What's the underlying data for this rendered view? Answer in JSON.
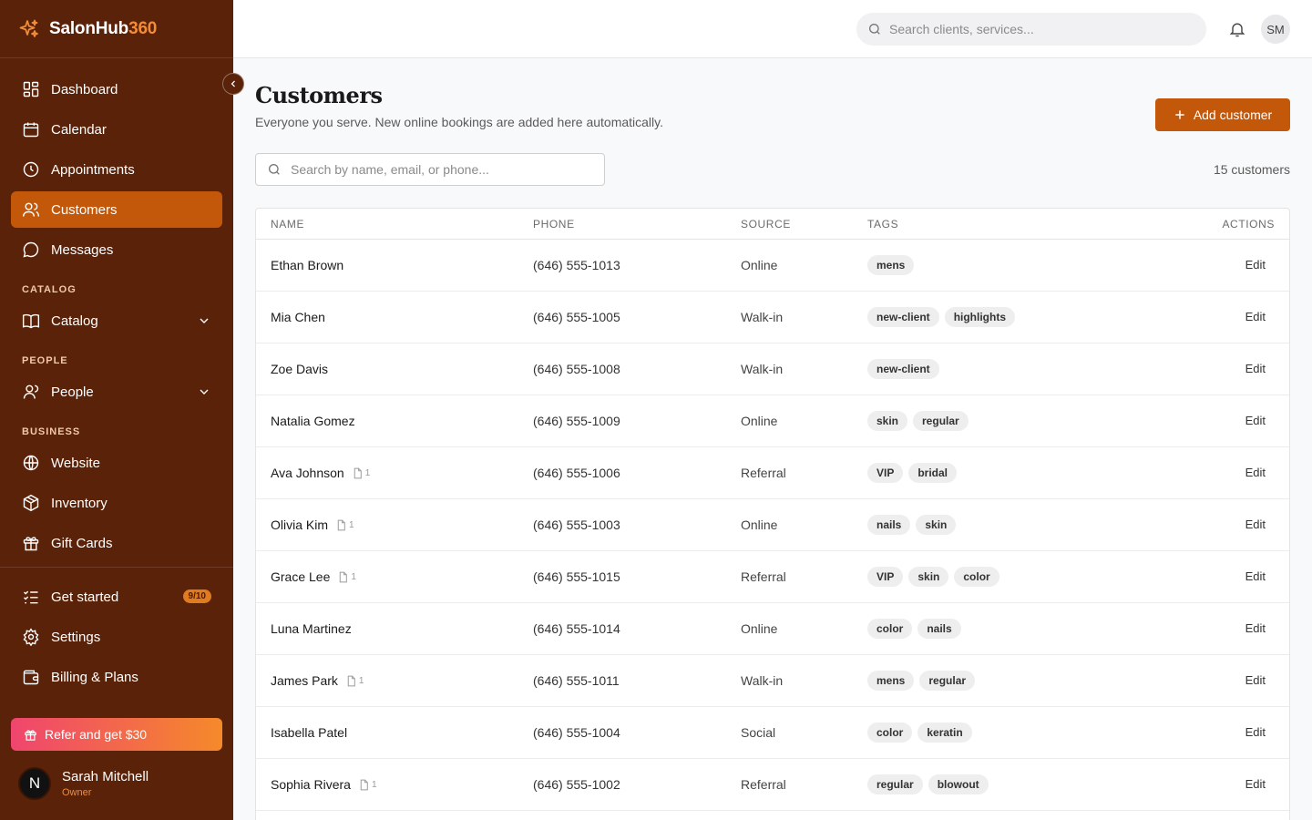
{
  "brand": {
    "name_main": "SalonHub",
    "name_accent": "360"
  },
  "sidebar": {
    "main_items": [
      {
        "label": "Dashboard",
        "icon": "grid-icon"
      },
      {
        "label": "Calendar",
        "icon": "calendar-icon"
      },
      {
        "label": "Appointments",
        "icon": "clock-icon"
      },
      {
        "label": "Customers",
        "icon": "users-icon",
        "active": true
      },
      {
        "label": "Messages",
        "icon": "message-icon"
      }
    ],
    "catalog_label": "CATALOG",
    "catalog_item": "Catalog",
    "people_label": "PEOPLE",
    "people_item": "People",
    "business_label": "BUSINESS",
    "business_items": [
      {
        "label": "Website",
        "icon": "globe-icon"
      },
      {
        "label": "Inventory",
        "icon": "box-icon"
      },
      {
        "label": "Gift Cards",
        "icon": "gift-icon"
      }
    ],
    "bottom_items": [
      {
        "label": "Get started",
        "icon": "checklist-icon",
        "badge": "9/10"
      },
      {
        "label": "Settings",
        "icon": "gear-icon"
      },
      {
        "label": "Billing & Plans",
        "icon": "wallet-icon"
      }
    ],
    "refer_label": "Refer and get $30",
    "user": {
      "initial": "N",
      "name": "Sarah Mitchell",
      "role": "Owner"
    }
  },
  "topbar": {
    "search_placeholder": "Search clients, services...",
    "avatar_initials": "SM"
  },
  "page": {
    "title": "Customers",
    "subtitle": "Everyone you serve. New online bookings are added here automatically.",
    "add_button": "Add customer",
    "search_placeholder": "Search by name, email, or phone...",
    "count": "15 customers"
  },
  "table": {
    "columns": [
      "NAME",
      "PHONE",
      "SOURCE",
      "TAGS",
      "ACTIONS"
    ],
    "edit_label": "Edit",
    "rows": [
      {
        "name": "Ethan Brown",
        "phone": "(646) 555-1013",
        "source": "Online",
        "tags": [
          "mens"
        ],
        "docs": null
      },
      {
        "name": "Mia Chen",
        "phone": "(646) 555-1005",
        "source": "Walk-in",
        "tags": [
          "new-client",
          "highlights"
        ],
        "docs": null
      },
      {
        "name": "Zoe Davis",
        "phone": "(646) 555-1008",
        "source": "Walk-in",
        "tags": [
          "new-client"
        ],
        "docs": null
      },
      {
        "name": "Natalia Gomez",
        "phone": "(646) 555-1009",
        "source": "Online",
        "tags": [
          "skin",
          "regular"
        ],
        "docs": null
      },
      {
        "name": "Ava Johnson",
        "phone": "(646) 555-1006",
        "source": "Referral",
        "tags": [
          "VIP",
          "bridal"
        ],
        "docs": "1"
      },
      {
        "name": "Olivia Kim",
        "phone": "(646) 555-1003",
        "source": "Online",
        "tags": [
          "nails",
          "skin"
        ],
        "docs": "1"
      },
      {
        "name": "Grace Lee",
        "phone": "(646) 555-1015",
        "source": "Referral",
        "tags": [
          "VIP",
          "skin",
          "color"
        ],
        "docs": "1"
      },
      {
        "name": "Luna Martinez",
        "phone": "(646) 555-1014",
        "source": "Online",
        "tags": [
          "color",
          "nails"
        ],
        "docs": null
      },
      {
        "name": "James Park",
        "phone": "(646) 555-1011",
        "source": "Walk-in",
        "tags": [
          "mens",
          "regular"
        ],
        "docs": "1"
      },
      {
        "name": "Isabella Patel",
        "phone": "(646) 555-1004",
        "source": "Social",
        "tags": [
          "color",
          "keratin"
        ],
        "docs": null
      },
      {
        "name": "Sophia Rivera",
        "phone": "(646) 555-1002",
        "source": "Referral",
        "tags": [
          "regular",
          "blowout"
        ],
        "docs": "1"
      }
    ]
  },
  "colors": {
    "sidebar_bg": "#5a2208",
    "accent": "#c4580a",
    "brand_accent": "#f28c38"
  }
}
